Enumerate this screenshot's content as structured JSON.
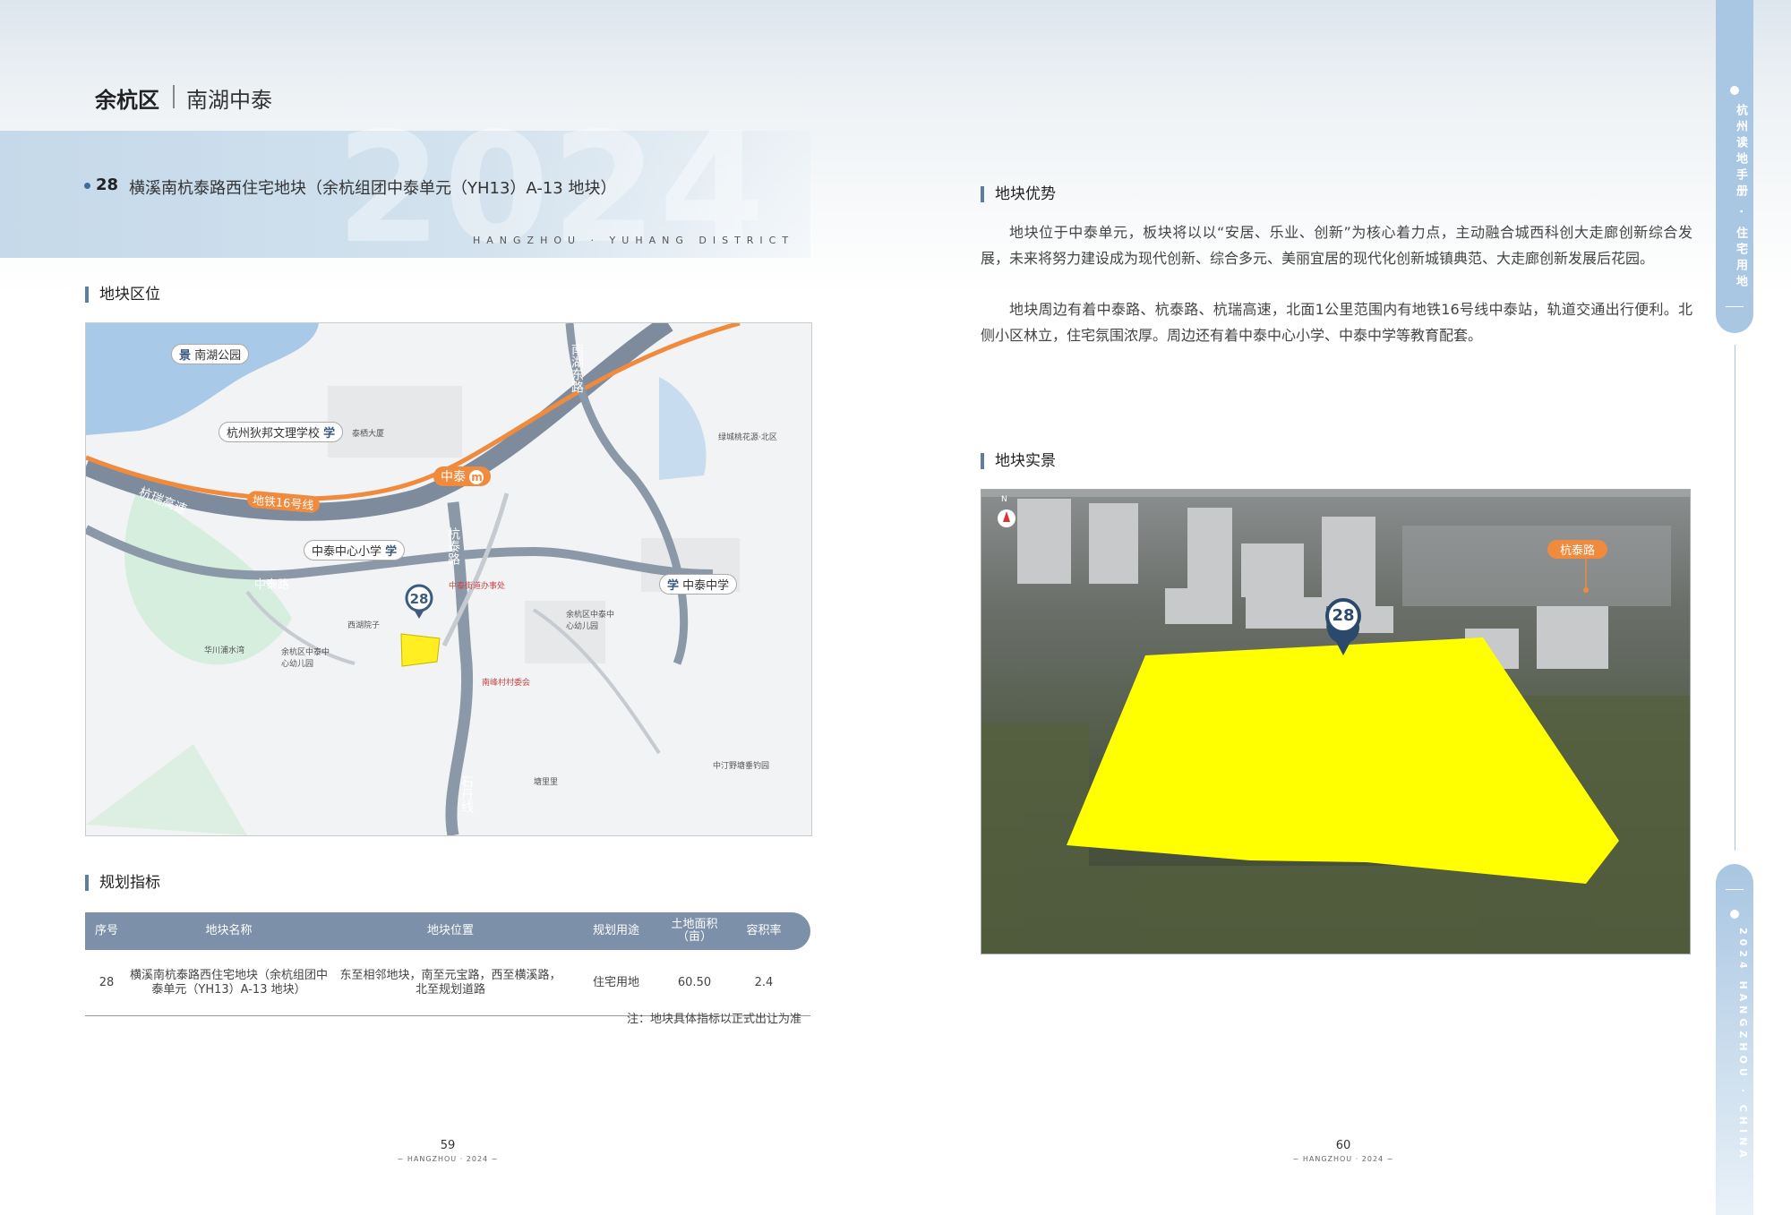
{
  "header": {
    "district": "余杭区",
    "area": "南湖中泰",
    "year_watermark": "2024",
    "subtitle": "HANGZHOU · YUHANG DISTRICT"
  },
  "plot": {
    "number": "28",
    "title": "横溪南杭泰路西住宅地块（余杭组团中泰单元（YH13）A-13 地块）"
  },
  "sections": {
    "location": "地块区位",
    "planning": "规划指标",
    "advantages": "地块优势",
    "photo": "地块实景"
  },
  "map": {
    "labels": {
      "park": "南湖公园",
      "school1": "杭州狄邦文理学校",
      "expressway": "杭瑞高速",
      "metro": "地铁16号线",
      "station": "中泰",
      "road_hangtai": "杭泰路",
      "road_nanhu_east": "南湖东路",
      "school2": "中泰中心小学",
      "school3": "中泰中学",
      "road_zhongtai": "中泰路",
      "road_shidan": "石丹线",
      "marker": "28",
      "small_taipai": "泰栖大厦",
      "small_cun": "中泰街道办事处",
      "small_kindergarten": "余杭区中泰中心幼儿园",
      "small_huaxi": "华川浦水湾",
      "small_xihu": "西湖院子",
      "small_youeryuan": "余杭区中泰中心幼儿园",
      "small_cunwei": "南峰村村委会",
      "small_lvcheng": "绿城桃花源·北区",
      "small_park2": "中汀野塘垂钓园",
      "small_tangli": "塘里里",
      "icon_school": "学",
      "icon_park": "景",
      "icon_metro": "m"
    }
  },
  "table": {
    "headers": [
      "序号",
      "地块名称",
      "地块位置",
      "规划用途",
      "土地面积（亩）",
      "容积率"
    ],
    "rows": [
      [
        "28",
        "横溪南杭泰路西住宅地块（余杭组团中泰单元（YH13）A-13 地块）",
        "东至相邻地块，南至元宝路，西至横溪路，北至规划道路",
        "住宅用地",
        "60.50",
        "2.4"
      ]
    ],
    "note": "注：地块具体指标以正式出让为准"
  },
  "advantages": {
    "p1": "地块位于中泰单元，板块将以以“安居、乐业、创新”为核心着力点，主动融合城西科创大走廊创新综合发展，未来将努力建设成为现代创新、综合多元、美丽宜居的现代化创新城镇典范、大走廊创新发展后花园。",
    "p2": "地块周边有着中泰路、杭泰路、杭瑞高速，北面1公里范围内有地铁16号线中泰站，轨道交通出行便利。北侧小区林立，住宅氛围浓厚。周边还有着中泰中心小学、中泰中学等教育配套。"
  },
  "photo": {
    "road_label": "杭泰路",
    "marker": "28",
    "north": "N"
  },
  "pages": {
    "left_no": "59",
    "right_no": "60",
    "footer": "~ HANGZHOU · 2024 ~"
  },
  "side_tabs": {
    "top": "杭州读地手册 · 住宅用地",
    "bottom": "2024 HANGZHOU · CHINA"
  },
  "colors": {
    "accent": "#7c90a9",
    "plot_highlight": "#ffff00",
    "metro_line": "#f08a3c",
    "marker": "#3d5a80"
  }
}
